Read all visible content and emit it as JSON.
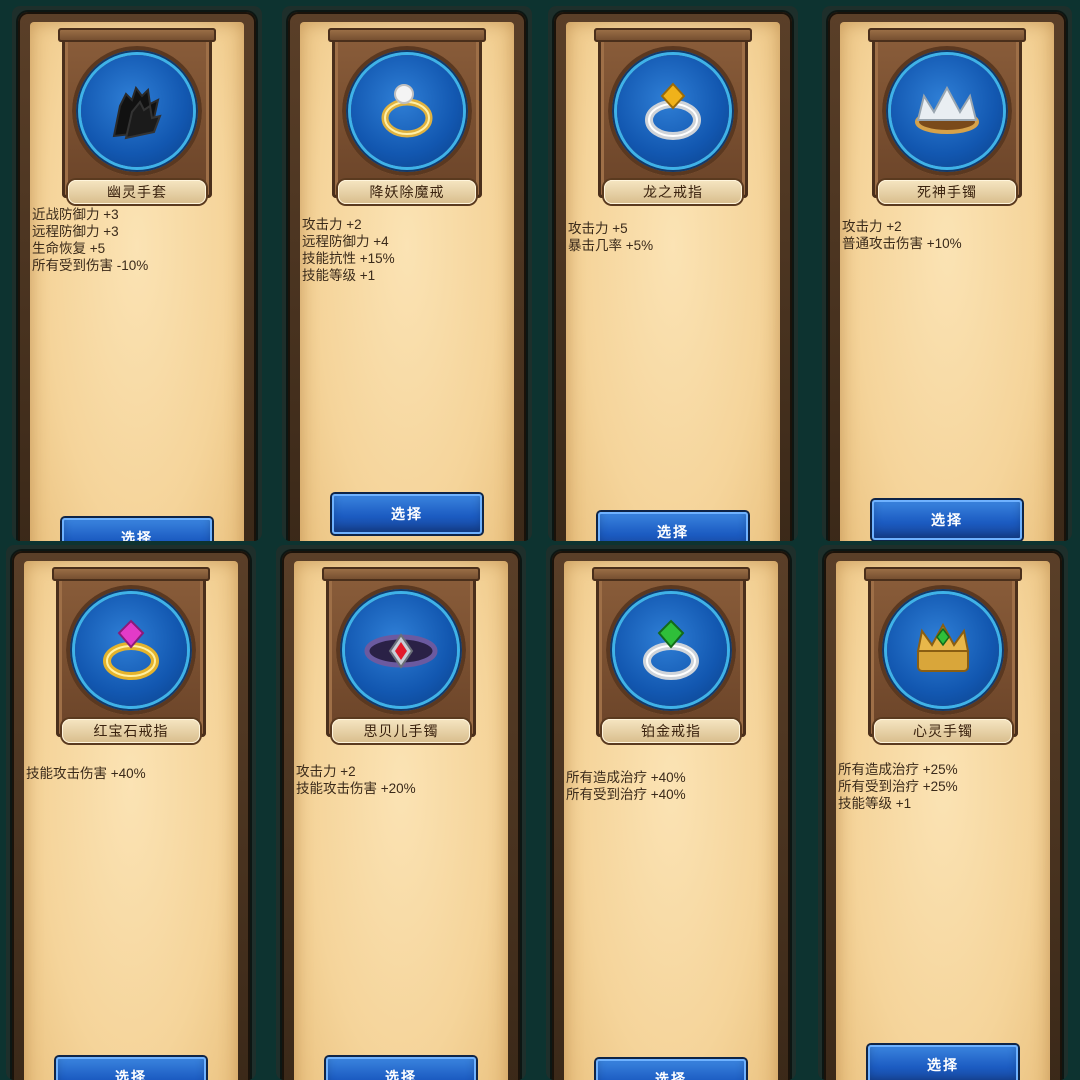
{
  "cards": [
    {
      "name": "幽灵手套",
      "stats": [
        "近战防御力 +3",
        "远程防御力 +3",
        "生命恢复 +5",
        "所有受到伤害 -10%"
      ],
      "button": "选择",
      "icon": "black-glove-icon"
    },
    {
      "name": "降妖除魔戒",
      "stats": [
        "攻击力 +2",
        "远程防御力 +4",
        "技能抗性 +15%",
        "技能等级 +1"
      ],
      "button": "选择",
      "icon": "gold-ring-pearl-icon"
    },
    {
      "name": "龙之戒指",
      "stats": [
        "攻击力 +5",
        "暴击几率 +5%"
      ],
      "button": "选择",
      "icon": "silver-ring-amber-gem-icon"
    },
    {
      "name": "死神手镯",
      "stats": [
        "攻击力 +2",
        "普通攻击伤害 +10%"
      ],
      "button": "选择",
      "icon": "gold-crown-bracelet-icon"
    },
    {
      "name": "红宝石戒指",
      "stats": [
        "技能攻击伤害 +40%"
      ],
      "button": "选择",
      "icon": "gold-ring-pink-gem-icon"
    },
    {
      "name": "思贝儿手镯",
      "stats": [
        "攻击力 +2",
        "技能攻击伤害 +20%"
      ],
      "button": "选择",
      "icon": "dark-bracelet-red-gem-icon"
    },
    {
      "name": "铂金戒指",
      "stats": [
        "所有造成治疗 +40%",
        "所有受到治疗 +40%"
      ],
      "button": "选择",
      "icon": "silver-ring-green-gem-icon"
    },
    {
      "name": "心灵手镯",
      "stats": [
        "所有造成治疗 +25%",
        "所有受到治疗 +25%",
        "技能等级 +1"
      ],
      "button": "选择",
      "icon": "gold-crown-green-gem-icon"
    }
  ],
  "colors": {
    "background": "#0d3330",
    "parchment": "#f5d49a",
    "medallion_blue": "#1257b0",
    "button_blue": "#1c5cc2"
  }
}
